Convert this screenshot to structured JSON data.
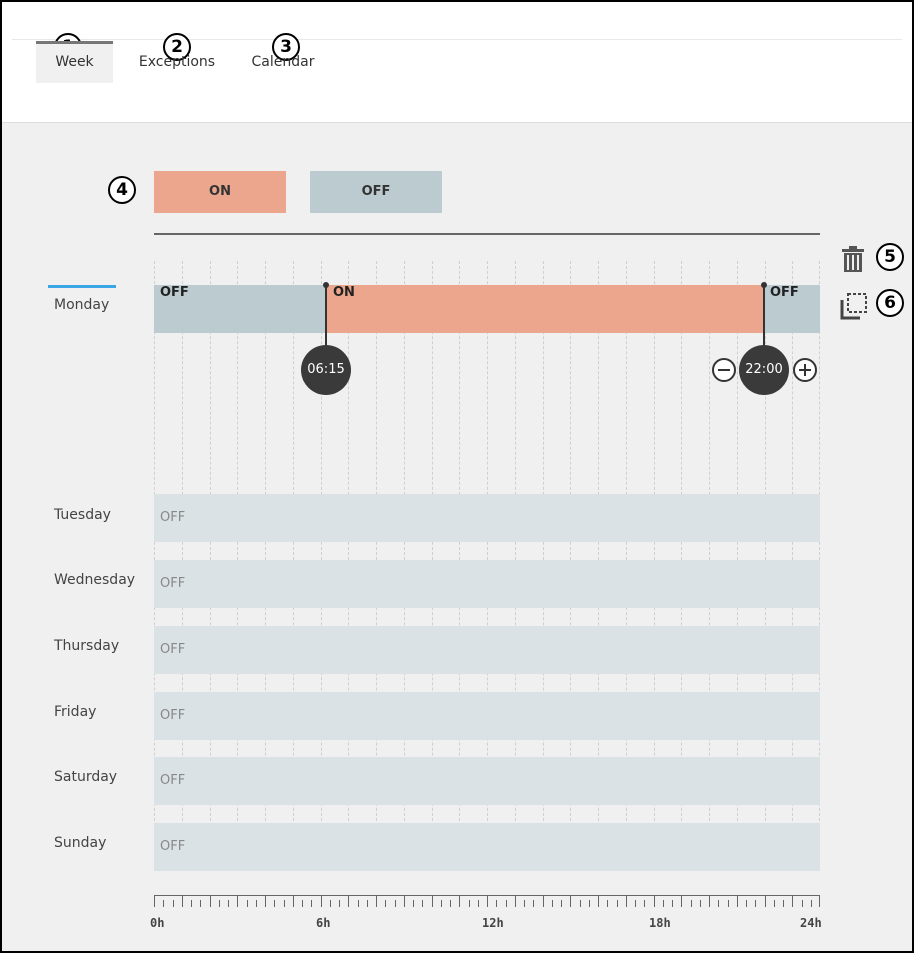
{
  "tabs": [
    {
      "label": "Week",
      "callout": "1",
      "active": true
    },
    {
      "label": "Exceptions",
      "callout": "2",
      "active": false
    },
    {
      "label": "Calendar",
      "callout": "3",
      "active": false
    }
  ],
  "legend": {
    "callout": "4",
    "on_label": "ON",
    "off_label": "OFF",
    "on_color": "#eca68e",
    "off_color": "#bccbd0"
  },
  "actions": {
    "delete": {
      "callout": "5",
      "icon": "trash-icon"
    },
    "copy": {
      "callout": "6",
      "icon": "copy-icon"
    }
  },
  "days": [
    {
      "name": "Monday",
      "selected": true
    },
    {
      "name": "Tuesday"
    },
    {
      "name": "Wednesday"
    },
    {
      "name": "Thursday"
    },
    {
      "name": "Friday"
    },
    {
      "name": "Saturday"
    },
    {
      "name": "Sunday"
    }
  ],
  "monday_schedule": {
    "segments": [
      {
        "state": "OFF",
        "start": "0:00",
        "end": "6:15"
      },
      {
        "state": "ON",
        "start": "6:15",
        "end": "22:00"
      },
      {
        "state": "OFF",
        "start": "22:00",
        "end": "24:00"
      }
    ],
    "handles": [
      {
        "time": "06:15",
        "hours": 6.25
      },
      {
        "time": "22:00",
        "hours": 22.0
      }
    ]
  },
  "default_state_label": "OFF",
  "axis": {
    "ticks": [
      "0h",
      "6h",
      "12h",
      "18h",
      "24h"
    ],
    "range_hours": [
      0,
      24
    ]
  }
}
